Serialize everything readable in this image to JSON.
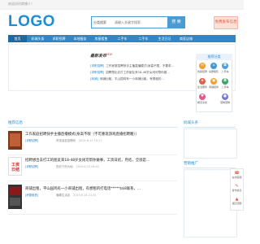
{
  "topbar": {
    "text": "欢迎访问商铺人！"
  },
  "header": {
    "logo": "LOGO",
    "search_category": "分类搜索",
    "search_placeholder": "请输入关键字搜索",
    "search_button": "搜 索",
    "post_button": "免费发布信息"
  },
  "nav": {
    "items": [
      "首页",
      "妈城头条",
      "求职招聘",
      "本地服务",
      "房屋租售",
      "二手车",
      "二手车",
      "生活日记",
      "商家店铺"
    ]
  },
  "news": {
    "title": "最新发布",
    "badge": "NEW",
    "lines": [
      {
        "tag": "[求职招聘]",
        "text": "工作家庭招聘快手主播直播模式(身高不限，不要求..."
      },
      {
        "tag": "[求职招聘]",
        "text": "招聘想出去打工的朋友来18-48岁女闲可帮你做..."
      },
      {
        "tag": "[商铺]",
        "text": "商铺出租，平山园鸡有一小商铺出租，有想租的..."
      }
    ]
  },
  "side_categories": {
    "title": "推荐分类",
    "items": [
      {
        "label": "找职招聘",
        "icon": "briefcase-icon",
        "glyph": "✉",
        "color": "#f0a030"
      },
      {
        "label": "房屋租售",
        "icon": "house-icon",
        "glyph": "⌂",
        "color": "#3f9ad8"
      },
      {
        "label": "二手车",
        "icon": "car-icon",
        "glyph": "◘",
        "color": "#4aa0e0"
      },
      {
        "label": "生活服务",
        "icon": "service-icon",
        "glyph": "★",
        "color": "#e0624a"
      },
      {
        "label": "商铺招商",
        "icon": "shop-icon",
        "glyph": "▣",
        "color": "#f0a030"
      },
      {
        "label": "二手车",
        "icon": "car2-icon",
        "glyph": "◘",
        "color": "#3aa66a"
      },
      {
        "label": "婚恋交友",
        "icon": "heart-icon",
        "glyph": "♥",
        "color": "#e05a8a"
      },
      {
        "label": "",
        "icon": "more-icon",
        "glyph": "",
        "color": "#ffffff"
      },
      {
        "label": "宠物宠物",
        "icon": "pet-icon",
        "glyph": "●",
        "color": "#7a7ad8"
      }
    ]
  },
  "sections": {
    "latest": "推荐信息",
    "right_top": "妈城头条",
    "right_bottom": "营销推广"
  },
  "listings": [
    {
      "title": "工作家庭招聘快手主播直播模式(身高不限（不可重现游戏直播招聘喔））",
      "category": "[求职招聘]",
      "user": "陈惠淑嘉招聘网",
      "date": "2019-6-15 10:17",
      "thumb_text": "",
      "thumb_color": "#7a3a1a"
    },
    {
      "title": "招聘想出去打工的朋友来18-48岁女闲可帮你做事，工资日结，月结，全部是...",
      "category": "[求职招聘]",
      "user": "阳光下的大地",
      "date": "2019-6-15 08:52",
      "thumb_text": "工资日结",
      "thumb_color": "#ffffff"
    },
    {
      "title": "商铺出租，平山园鸡有一小商铺出租，有想租的打电话*****$$8联系，...",
      "category": "[房屋租售]",
      "user": "糖果生活店",
      "date": "2019-6-14 21:41",
      "thumb_text": "",
      "thumb_color": "#333333"
    }
  ],
  "float_bar": [
    {
      "label": "在线客服",
      "icon": "chat-icon",
      "glyph": "☎"
    },
    {
      "label": "发布信息",
      "icon": "edit-icon",
      "glyph": "✎"
    },
    {
      "label": "返回顶部",
      "icon": "up-icon",
      "glyph": "▲"
    }
  ]
}
